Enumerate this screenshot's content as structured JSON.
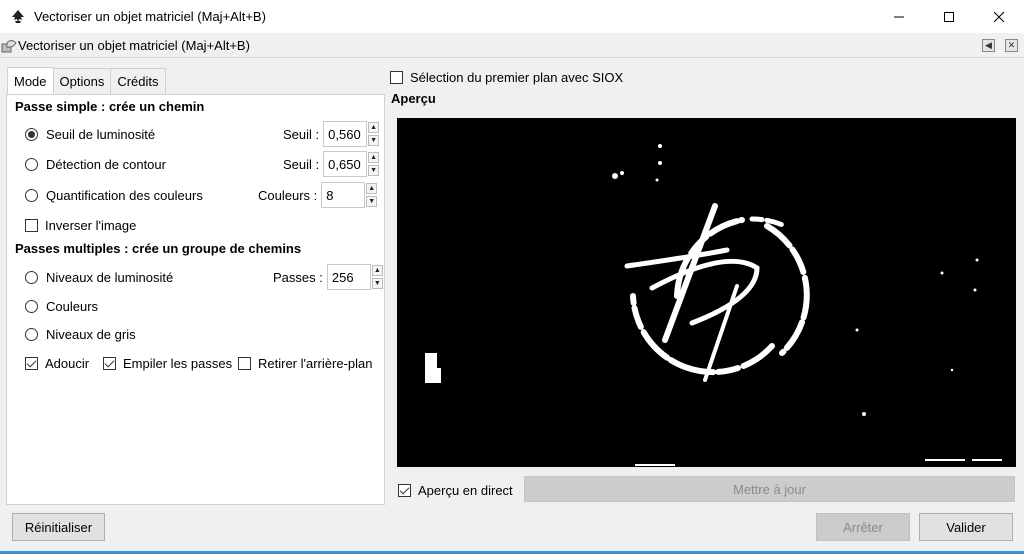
{
  "window": {
    "title": "Vectoriser un objet matriciel (Maj+Alt+B)",
    "controls": [
      "minimize",
      "maximize",
      "close"
    ]
  },
  "dock": {
    "title": "Vectoriser un objet matriciel (Maj+Alt+B)"
  },
  "tabs": [
    {
      "label": "Mode",
      "active": true
    },
    {
      "label": "Options",
      "active": false
    },
    {
      "label": "Crédits",
      "active": false
    }
  ],
  "single_pass": {
    "title": "Passe simple : crée un chemin",
    "options": [
      {
        "label": "Seuil de luminosité",
        "checked": true,
        "field_label": "Seuil :",
        "value": "0,560"
      },
      {
        "label": "Détection de contour",
        "checked": false,
        "field_label": "Seuil :",
        "value": "0,650"
      },
      {
        "label": "Quantification des couleurs",
        "checked": false,
        "field_label": "Couleurs :",
        "value": "8"
      }
    ],
    "invert": {
      "label": "Inverser l'image",
      "checked": false
    }
  },
  "multi_pass": {
    "title": "Passes multiples : crée un groupe de chemins",
    "options": [
      {
        "label": "Niveaux de luminosité",
        "checked": false,
        "field_label": "Passes :",
        "value": "256"
      },
      {
        "label": "Couleurs",
        "checked": false
      },
      {
        "label": "Niveaux de gris",
        "checked": false
      }
    ],
    "smooth": {
      "label": "Adoucir",
      "checked": true
    },
    "stack": {
      "label": "Empiler les passes",
      "checked": true
    },
    "remove_bg": {
      "label": "Retirer l'arrière-plan",
      "checked": false
    }
  },
  "siox": {
    "label": "Sélection du premier plan avec SIOX",
    "checked": false
  },
  "preview": {
    "title": "Aperçu",
    "live": {
      "label": "Aperçu en direct",
      "checked": true
    },
    "update_label": "Mettre à jour"
  },
  "buttons": {
    "reset": "Réinitialiser",
    "stop": "Arrêter",
    "ok": "Valider"
  },
  "colors": {
    "preview_bg": "#000000",
    "accent_line": "#3c8fd0",
    "disabled_text": "#8a8a8a"
  }
}
